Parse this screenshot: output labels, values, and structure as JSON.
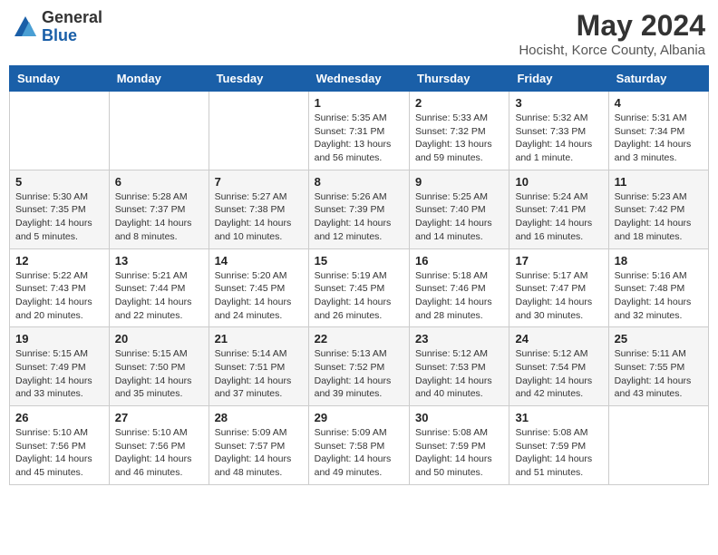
{
  "header": {
    "logo_general": "General",
    "logo_blue": "Blue",
    "month_title": "May 2024",
    "location": "Hocisht, Korce County, Albania"
  },
  "days_of_week": [
    "Sunday",
    "Monday",
    "Tuesday",
    "Wednesday",
    "Thursday",
    "Friday",
    "Saturday"
  ],
  "weeks": [
    [
      {
        "day": "",
        "info": ""
      },
      {
        "day": "",
        "info": ""
      },
      {
        "day": "",
        "info": ""
      },
      {
        "day": "1",
        "info": "Sunrise: 5:35 AM\nSunset: 7:31 PM\nDaylight: 13 hours and 56 minutes."
      },
      {
        "day": "2",
        "info": "Sunrise: 5:33 AM\nSunset: 7:32 PM\nDaylight: 13 hours and 59 minutes."
      },
      {
        "day": "3",
        "info": "Sunrise: 5:32 AM\nSunset: 7:33 PM\nDaylight: 14 hours and 1 minute."
      },
      {
        "day": "4",
        "info": "Sunrise: 5:31 AM\nSunset: 7:34 PM\nDaylight: 14 hours and 3 minutes."
      }
    ],
    [
      {
        "day": "5",
        "info": "Sunrise: 5:30 AM\nSunset: 7:35 PM\nDaylight: 14 hours and 5 minutes."
      },
      {
        "day": "6",
        "info": "Sunrise: 5:28 AM\nSunset: 7:37 PM\nDaylight: 14 hours and 8 minutes."
      },
      {
        "day": "7",
        "info": "Sunrise: 5:27 AM\nSunset: 7:38 PM\nDaylight: 14 hours and 10 minutes."
      },
      {
        "day": "8",
        "info": "Sunrise: 5:26 AM\nSunset: 7:39 PM\nDaylight: 14 hours and 12 minutes."
      },
      {
        "day": "9",
        "info": "Sunrise: 5:25 AM\nSunset: 7:40 PM\nDaylight: 14 hours and 14 minutes."
      },
      {
        "day": "10",
        "info": "Sunrise: 5:24 AM\nSunset: 7:41 PM\nDaylight: 14 hours and 16 minutes."
      },
      {
        "day": "11",
        "info": "Sunrise: 5:23 AM\nSunset: 7:42 PM\nDaylight: 14 hours and 18 minutes."
      }
    ],
    [
      {
        "day": "12",
        "info": "Sunrise: 5:22 AM\nSunset: 7:43 PM\nDaylight: 14 hours and 20 minutes."
      },
      {
        "day": "13",
        "info": "Sunrise: 5:21 AM\nSunset: 7:44 PM\nDaylight: 14 hours and 22 minutes."
      },
      {
        "day": "14",
        "info": "Sunrise: 5:20 AM\nSunset: 7:45 PM\nDaylight: 14 hours and 24 minutes."
      },
      {
        "day": "15",
        "info": "Sunrise: 5:19 AM\nSunset: 7:45 PM\nDaylight: 14 hours and 26 minutes."
      },
      {
        "day": "16",
        "info": "Sunrise: 5:18 AM\nSunset: 7:46 PM\nDaylight: 14 hours and 28 minutes."
      },
      {
        "day": "17",
        "info": "Sunrise: 5:17 AM\nSunset: 7:47 PM\nDaylight: 14 hours and 30 minutes."
      },
      {
        "day": "18",
        "info": "Sunrise: 5:16 AM\nSunset: 7:48 PM\nDaylight: 14 hours and 32 minutes."
      }
    ],
    [
      {
        "day": "19",
        "info": "Sunrise: 5:15 AM\nSunset: 7:49 PM\nDaylight: 14 hours and 33 minutes."
      },
      {
        "day": "20",
        "info": "Sunrise: 5:15 AM\nSunset: 7:50 PM\nDaylight: 14 hours and 35 minutes."
      },
      {
        "day": "21",
        "info": "Sunrise: 5:14 AM\nSunset: 7:51 PM\nDaylight: 14 hours and 37 minutes."
      },
      {
        "day": "22",
        "info": "Sunrise: 5:13 AM\nSunset: 7:52 PM\nDaylight: 14 hours and 39 minutes."
      },
      {
        "day": "23",
        "info": "Sunrise: 5:12 AM\nSunset: 7:53 PM\nDaylight: 14 hours and 40 minutes."
      },
      {
        "day": "24",
        "info": "Sunrise: 5:12 AM\nSunset: 7:54 PM\nDaylight: 14 hours and 42 minutes."
      },
      {
        "day": "25",
        "info": "Sunrise: 5:11 AM\nSunset: 7:55 PM\nDaylight: 14 hours and 43 minutes."
      }
    ],
    [
      {
        "day": "26",
        "info": "Sunrise: 5:10 AM\nSunset: 7:56 PM\nDaylight: 14 hours and 45 minutes."
      },
      {
        "day": "27",
        "info": "Sunrise: 5:10 AM\nSunset: 7:56 PM\nDaylight: 14 hours and 46 minutes."
      },
      {
        "day": "28",
        "info": "Sunrise: 5:09 AM\nSunset: 7:57 PM\nDaylight: 14 hours and 48 minutes."
      },
      {
        "day": "29",
        "info": "Sunrise: 5:09 AM\nSunset: 7:58 PM\nDaylight: 14 hours and 49 minutes."
      },
      {
        "day": "30",
        "info": "Sunrise: 5:08 AM\nSunset: 7:59 PM\nDaylight: 14 hours and 50 minutes."
      },
      {
        "day": "31",
        "info": "Sunrise: 5:08 AM\nSunset: 7:59 PM\nDaylight: 14 hours and 51 minutes."
      },
      {
        "day": "",
        "info": ""
      }
    ]
  ]
}
